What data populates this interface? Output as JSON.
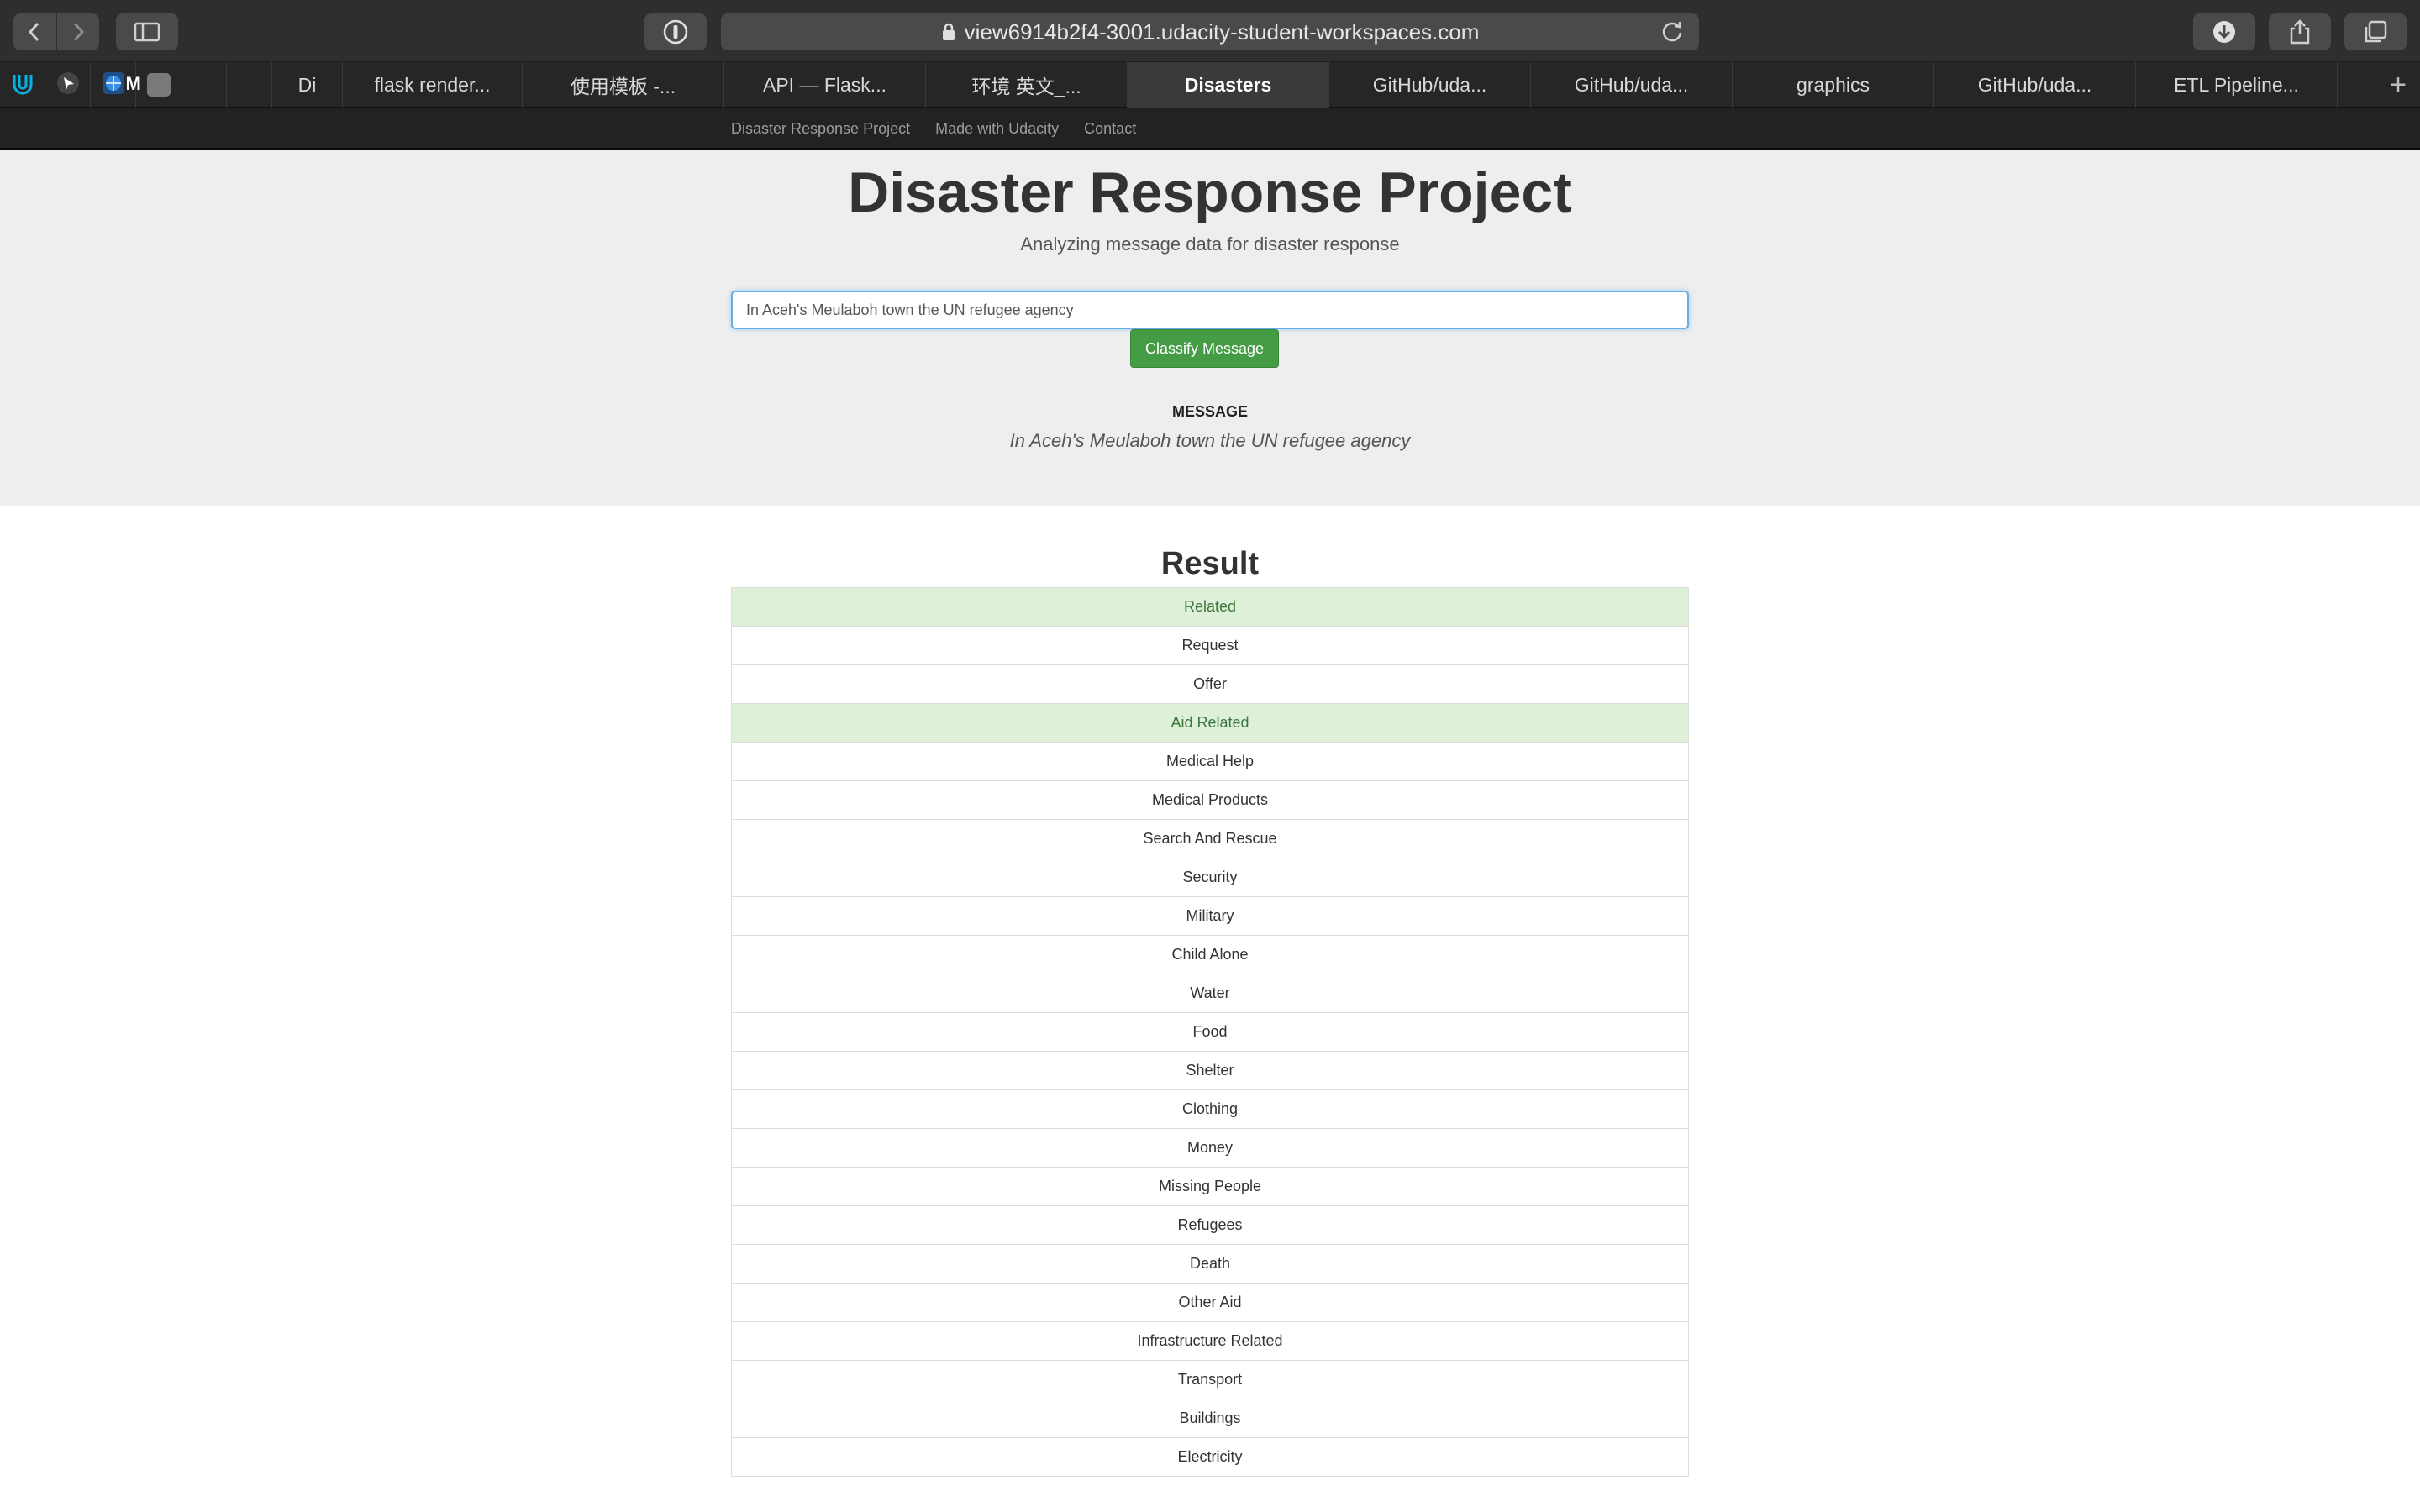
{
  "browser": {
    "url": "view6914b2f4-3001.udacity-student-workspaces.com",
    "pinned": [
      {
        "icon": "udacity-icon",
        "color": "#02b3e4",
        "letter": ""
      },
      {
        "icon": "app-icon",
        "color": "#ffffff",
        "letter": ""
      },
      {
        "icon": "globe-icon",
        "color": "#3b8ddf",
        "letter": ""
      },
      {
        "icon": "m-icon",
        "color": "#7a7a7a",
        "letter": "M"
      },
      {
        "icon": "blank-icon",
        "color": "#262626",
        "letter": ""
      },
      {
        "icon": "blank-icon",
        "color": "#262626",
        "letter": ""
      }
    ],
    "tabs": [
      {
        "label": "Di",
        "active": false
      },
      {
        "label": "flask render...",
        "active": false
      },
      {
        "label": "使用模板 -...",
        "active": false
      },
      {
        "label": "API — Flask...",
        "active": false
      },
      {
        "label": "环境 英文_...",
        "active": false
      },
      {
        "label": "Disasters",
        "active": true
      },
      {
        "label": "GitHub/uda...",
        "active": false
      },
      {
        "label": "GitHub/uda...",
        "active": false
      },
      {
        "label": "graphics",
        "active": false
      },
      {
        "label": "GitHub/uda...",
        "active": false
      },
      {
        "label": "ETL Pipeline...",
        "active": false
      }
    ],
    "new_tab": "+"
  },
  "navbar": {
    "brand": "Disaster Response Project",
    "links": [
      "Made with Udacity",
      "Contact"
    ]
  },
  "header": {
    "title": "Disaster Response Project",
    "subtitle": "Analyzing message data for disaster response"
  },
  "form": {
    "query_value": "In Aceh's Meulaboh town the UN refugee agency",
    "button": "Classify Message"
  },
  "message": {
    "heading": "MESSAGE",
    "text": "In Aceh's Meulaboh town the UN refugee agency"
  },
  "result": {
    "heading": "Result",
    "highlight_color": "#dff0d8",
    "categories": [
      {
        "label": "Related",
        "active": true
      },
      {
        "label": "Request",
        "active": false
      },
      {
        "label": "Offer",
        "active": false
      },
      {
        "label": "Aid Related",
        "active": true
      },
      {
        "label": "Medical Help",
        "active": false
      },
      {
        "label": "Medical Products",
        "active": false
      },
      {
        "label": "Search And Rescue",
        "active": false
      },
      {
        "label": "Security",
        "active": false
      },
      {
        "label": "Military",
        "active": false
      },
      {
        "label": "Child Alone",
        "active": false
      },
      {
        "label": "Water",
        "active": false
      },
      {
        "label": "Food",
        "active": false
      },
      {
        "label": "Shelter",
        "active": false
      },
      {
        "label": "Clothing",
        "active": false
      },
      {
        "label": "Money",
        "active": false
      },
      {
        "label": "Missing People",
        "active": false
      },
      {
        "label": "Refugees",
        "active": false
      },
      {
        "label": "Death",
        "active": false
      },
      {
        "label": "Other Aid",
        "active": false
      },
      {
        "label": "Infrastructure Related",
        "active": false
      },
      {
        "label": "Transport",
        "active": false
      },
      {
        "label": "Buildings",
        "active": false
      },
      {
        "label": "Electricity",
        "active": false
      }
    ]
  }
}
